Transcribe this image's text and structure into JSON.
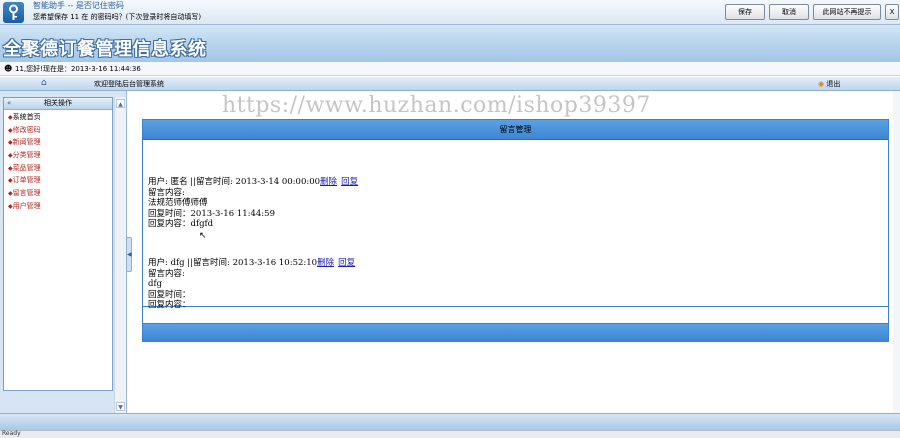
{
  "password_bar": {
    "title": "智能助手 -- 是否记住密码",
    "question": "您希望保存 11 在  的密码吗？(下次登录时将自动填写)",
    "save_label": "保存",
    "cancel_label": "取消",
    "never_label": "此网站不再提示",
    "close_label": "X"
  },
  "app": {
    "title": "全聚德订餐管理信息系统"
  },
  "user_bar": {
    "text": "11,您好!现在是：2013-3-16 11:44:36"
  },
  "nav": {
    "welcome": "欢迎登陆后台管理系统",
    "logout": "退出"
  },
  "sidebar": {
    "heading": "相关操作",
    "items": [
      {
        "label": "系统首页"
      },
      {
        "label": "修改密码"
      },
      {
        "label": "新闻管理"
      },
      {
        "label": "分类管理"
      },
      {
        "label": "菜品管理"
      },
      {
        "label": "订单管理"
      },
      {
        "label": "留言管理"
      },
      {
        "label": "用户管理"
      }
    ]
  },
  "watermark": "https://www.huzhan.com/ishop39397",
  "messages_panel": {
    "title": "留言管理",
    "messages": [
      {
        "user_line": "用户: 匿名 ||留言时间: 2013-3-14 00:00:00",
        "delete_label": "删除",
        "reply_label": "回复",
        "content_label": "留言内容:",
        "content": "法规范师傅师傅",
        "reply_time": "回复时间：2013-3-16 11:44:59",
        "reply_content": "回复内容：dfgfd"
      },
      {
        "user_line": "用户: dfg ||留言时间: 2013-3-16 10:52:10",
        "delete_label": "删除",
        "reply_label": "回复",
        "content_label": "留言内容:",
        "content": "dfg",
        "reply_time": "回复时间：",
        "reply_content": "回复内容："
      }
    ]
  },
  "taskbar": {
    "left_text": "Ready",
    "right_text": ""
  }
}
